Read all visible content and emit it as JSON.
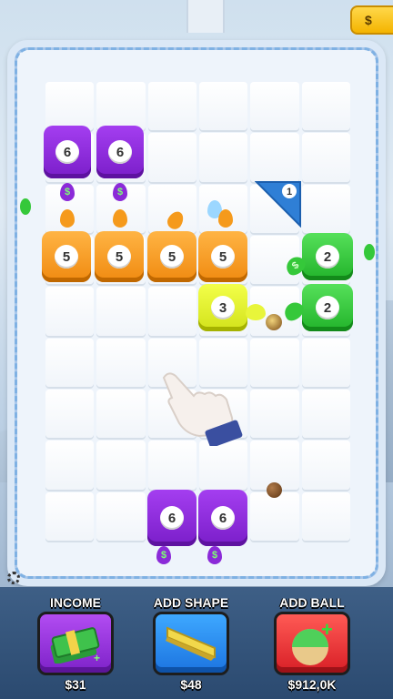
{
  "top": {
    "coin_label": "$"
  },
  "board": {
    "pieces": [
      {
        "id": "purple-6-a",
        "color": "purple",
        "value": "6"
      },
      {
        "id": "purple-6-b",
        "color": "purple",
        "value": "6"
      },
      {
        "id": "orange-5-a",
        "color": "orange",
        "value": "5"
      },
      {
        "id": "orange-5-b",
        "color": "orange",
        "value": "5"
      },
      {
        "id": "orange-5-c",
        "color": "orange",
        "value": "5"
      },
      {
        "id": "orange-5-d",
        "color": "orange",
        "value": "5"
      },
      {
        "id": "green-2-a",
        "color": "green",
        "value": "2"
      },
      {
        "id": "green-2-b",
        "color": "green",
        "value": "2"
      },
      {
        "id": "yellow-3",
        "color": "yellow",
        "value": "3"
      },
      {
        "id": "purple-6-c",
        "color": "purple",
        "value": "6"
      },
      {
        "id": "purple-6-d",
        "color": "purple",
        "value": "6"
      },
      {
        "id": "triangle-1",
        "color": "blue",
        "value": "1"
      }
    ],
    "drop_symbol": "$"
  },
  "shop": {
    "income": {
      "title": "INCOME",
      "price": "$31"
    },
    "add_shape": {
      "title": "ADD SHAPE",
      "price": "$48"
    },
    "add_ball": {
      "title": "ADD BALL",
      "price": "$912,0K"
    }
  },
  "colors": {
    "purple": "#8b2ad8",
    "orange": "#f59a1c",
    "green": "#35c83a",
    "yellow": "#e2f12a",
    "blue": "#2f7fd6"
  }
}
